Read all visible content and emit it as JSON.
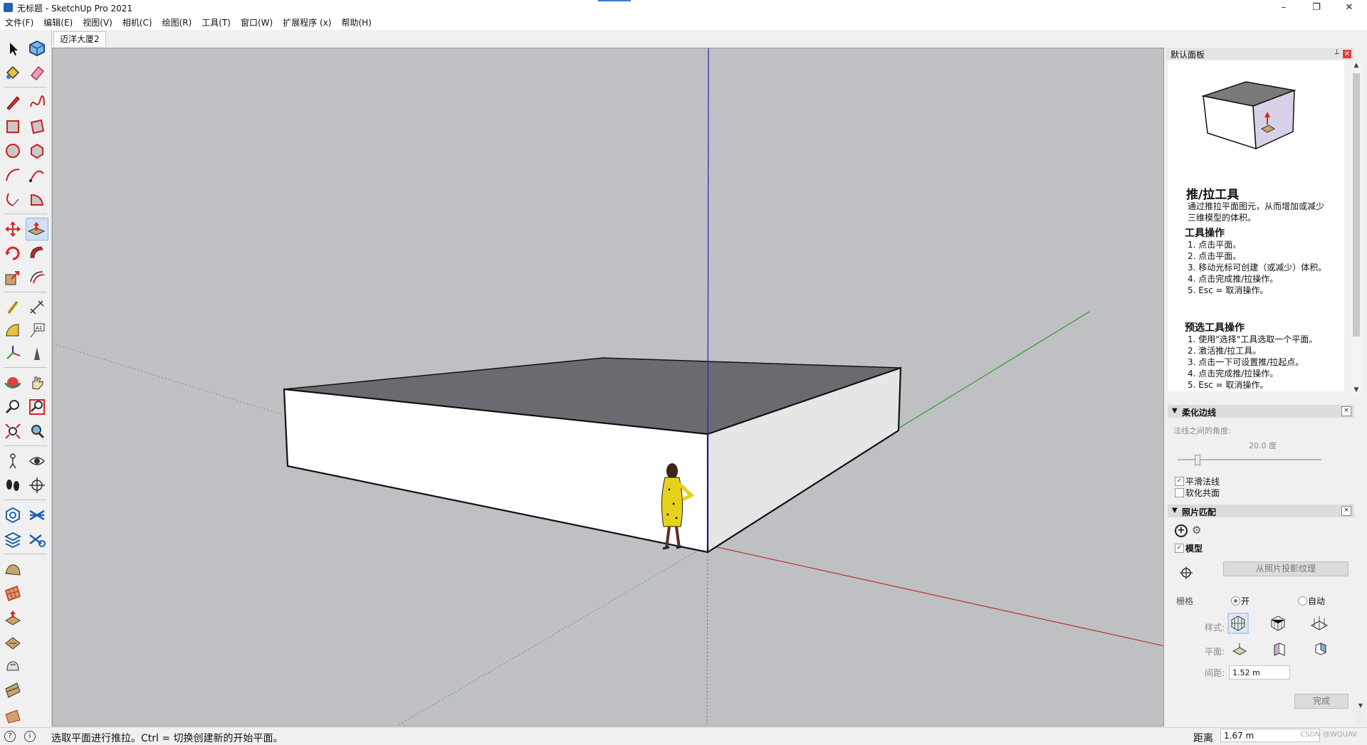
{
  "window": {
    "title": "无标题 - SketchUp Pro 2021",
    "minimize": "–",
    "restore": "❐",
    "close": "✕"
  },
  "menu": [
    "文件(F)",
    "编辑(E)",
    "视图(V)",
    "相机(C)",
    "绘图(R)",
    "工具(T)",
    "窗口(W)",
    "扩展程序 (x)",
    "帮助(H)"
  ],
  "tabs": [
    {
      "label": "迈洋大厦2",
      "active": true
    }
  ],
  "toolbar": {
    "active_tool": "push-pull",
    "tools": [
      "select",
      "component",
      "paint-bucket",
      "eraser",
      "pencil",
      "freehand",
      "rectangle",
      "rotated-rectangle",
      "circle",
      "polygon",
      "arc",
      "two-point-arc",
      "three-point-arc",
      "pie",
      "move",
      "push-pull",
      "rotate",
      "follow-me",
      "scale",
      "offset",
      "tape-measure",
      "dimension",
      "protractor",
      "text",
      "axes",
      "3d-text",
      "orbit",
      "pan",
      "zoom",
      "zoom-window",
      "zoom-extents",
      "previous-view",
      "position-camera",
      "look-around",
      "walk",
      "section-plane",
      "outliner",
      "layers",
      "components",
      "styles",
      "sandbox-smoove",
      "sandbox-stamp",
      "sandbox-drape",
      "sandbox-add-detail",
      "sandbox-flip-edge",
      "sandbox-from-contours",
      "sandbox-from-scratch"
    ]
  },
  "colors": {
    "viewport_bg": "#bfc0c4",
    "axis_red": "#c0302a",
    "axis_green": "#2f9a2f",
    "axis_blue": "#2020c8",
    "face_front": "#ffffff",
    "face_side": "#e6e6e6",
    "face_top": "#6a6b70",
    "accent": "#3a7bd5"
  },
  "default_tray": {
    "header": "默认面板",
    "pin_icon": "pin-icon",
    "instructor": {
      "tool_title": "推/拉工具",
      "tool_desc": "通过推拉平面图元，从而增加或减少三维模型的体积。",
      "ops_heading": "工具操作",
      "ops": [
        "1. 点击平面。",
        "2. 点击平面。",
        "3. 移动光标可创建（或减少）体积。",
        "4. 点击完成推/拉操作。",
        "5. Esc = 取消操作。"
      ],
      "pre_heading": "预选工具操作",
      "pre_ops": [
        "1. 使用\"选择\"工具选取一个平面。",
        "2. 激活推/拉工具。",
        "3. 点击一下可设置推/拉起点。",
        "4. 点击完成推/拉操作。",
        "5. Esc = 取消操作。"
      ]
    },
    "soften": {
      "header": "柔化边线",
      "angle_label": "法线之间的角度:",
      "angle_value": "20.0  度",
      "slider_fraction": 0.12,
      "smooth_normals": "平滑法线",
      "smooth_normals_checked": true,
      "soften_coplanar": "软化共面",
      "soften_coplanar_checked": false
    },
    "match_photo": {
      "header": "照片匹配",
      "model_label": "模型",
      "model_checked": true,
      "project_btn": "从照片投影纹理",
      "grid_label": "栅格",
      "on_label": "开",
      "auto_label": "自动",
      "style_label": "样式:",
      "plane_label": "平面:",
      "spacing_label": "间距:",
      "spacing_value": "1.52 m",
      "done_btn": "完成"
    }
  },
  "status": {
    "message": "选取平面进行推拉。Ctrl = 切换创建新的开始平面。",
    "distance_label": "距离",
    "distance_value": "1.67 m",
    "watermark": "CSDN @WQUAV"
  }
}
